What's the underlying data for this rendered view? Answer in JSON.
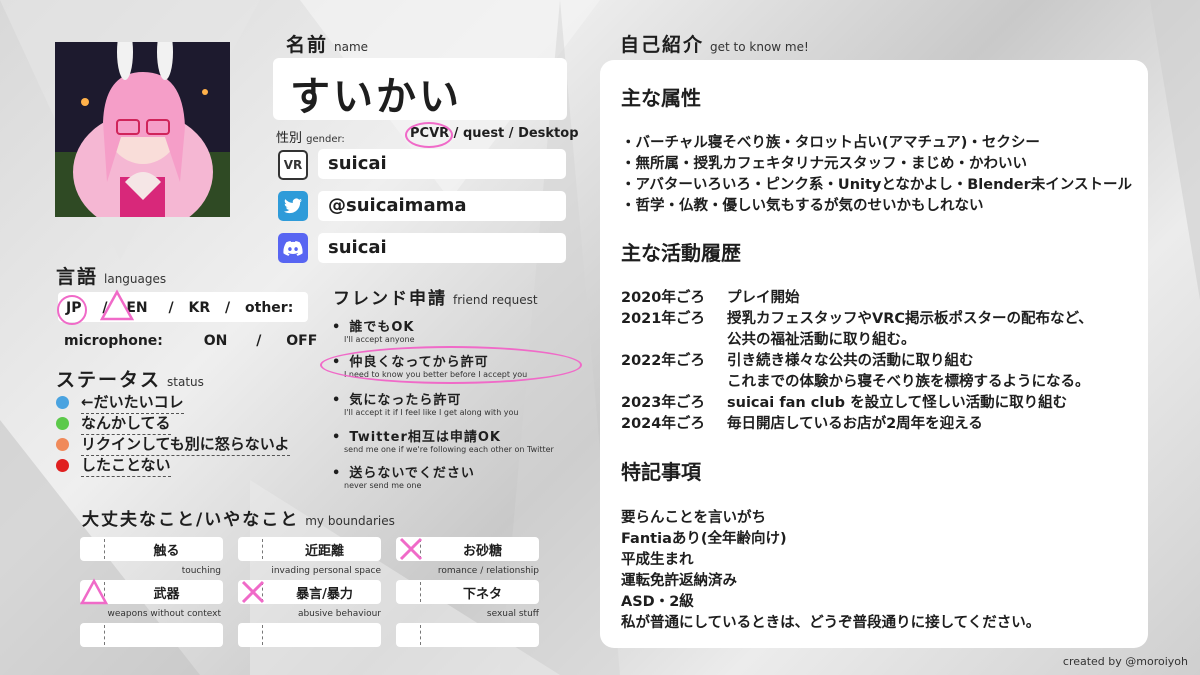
{
  "name_section": {
    "heading": "名前",
    "heading_en": "name",
    "value": "すいかい"
  },
  "gender": {
    "label": "性別",
    "label_en": "gender:",
    "opt1": "PCVR",
    "opt2": " / quest / Desktop"
  },
  "social": [
    {
      "icon": "vr-icon",
      "icon_text": "VR",
      "color": "#ffffff",
      "value": "suicai"
    },
    {
      "icon": "twitter-icon",
      "color": "#2e9bd9",
      "value": "@suicaimama"
    },
    {
      "icon": "discord-icon",
      "color": "#5865f2",
      "value": "suicai"
    }
  ],
  "languages": {
    "heading": "言語",
    "heading_en": "languages",
    "jp": "JP",
    "en": "EN",
    "sep": "/",
    "kr": "KR",
    "other": "other:",
    "mic_label": "microphone:",
    "on": "ON",
    "off": "OFF"
  },
  "status": {
    "heading": "ステータス",
    "heading_en": "status",
    "items": [
      {
        "text": "←だいたいコレ",
        "color": "#4aa3e0"
      },
      {
        "text": "なんかしてる",
        "color": "#5cc94a"
      },
      {
        "text": "リクインしても別に怒らないよ",
        "color": "#f08a5a"
      },
      {
        "text": "したことない",
        "color": "#e02020"
      }
    ]
  },
  "friend": {
    "heading": "フレンド申請",
    "heading_en": "friend request",
    "items": [
      {
        "jp": "誰でもOK",
        "en": "I'll accept anyone"
      },
      {
        "jp": "仲良くなってから許可",
        "en": "I need to know you better before I accept you"
      },
      {
        "jp": "気になったら許可",
        "en": "I'll accept it if I feel like I get along with you"
      },
      {
        "jp": "Twitter相互は申請OK",
        "en": "send me one if we're following each other on Twitter"
      },
      {
        "jp": "送らないでください",
        "en": "never send me one"
      }
    ]
  },
  "boundaries": {
    "heading": "大丈夫なこと/いやなこと",
    "heading_en": "my boundaries",
    "items": [
      {
        "jp": "触る",
        "en": "touching"
      },
      {
        "jp": "近距離",
        "en": "invading personal space"
      },
      {
        "jp": "お砂糖",
        "en": "romance / relationship"
      },
      {
        "jp": "武器",
        "en": "weapons without context"
      },
      {
        "jp": "暴言/暴力",
        "en": "abusive behaviour"
      },
      {
        "jp": "下ネタ",
        "en": "sexual stuff"
      }
    ]
  },
  "intro": {
    "heading": "自己紹介",
    "heading_en": "get to know me!",
    "attr_heading": "主な属性",
    "attrs": [
      "・バーチャル寝そべり族・タロット占い(アマチュア)・セクシー",
      "・無所属・授乳カフェキタリナ元スタッフ・まじめ・かわいい",
      "・アバターいろいろ・ピンク系・Unityとなかよし・Blender未インストール",
      "・哲学・仏教・優しい気もするが気のせいかもしれない"
    ],
    "history_heading": "主な活動履歴",
    "history": [
      {
        "year": "2020年ごろ",
        "text": "プレイ開始"
      },
      {
        "year": "2021年ごろ",
        "text": "授乳カフェスタッフやVRC掲示板ポスターの配布など、"
      },
      {
        "year": "",
        "text": "公共の福祉活動に取り組む。"
      },
      {
        "year": "2022年ごろ",
        "text": "引き続き様々な公共の活動に取り組む"
      },
      {
        "year": "",
        "text": "これまでの体験から寝そべり族を標榜するようになる。"
      },
      {
        "year": "2023年ごろ",
        "text": "suicai fan club を設立して怪しい活動に取り組む"
      },
      {
        "year": "2024年ごろ",
        "text": "毎日開店しているお店が2周年を迎える"
      }
    ],
    "notes_heading": "特記事項",
    "notes": [
      "要らんことを言いがち",
      "Fantiaあり(全年齢向け)",
      "平成生まれ",
      "運転免許返納済み",
      "ASD・2級",
      "私が普通にしているときは、どうぞ普段通りに接してください。"
    ]
  },
  "credit": "created by @moroiyoh",
  "accent": "#f06ac8"
}
